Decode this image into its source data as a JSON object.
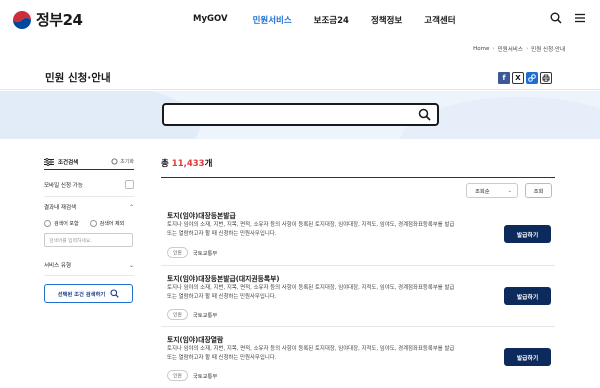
{
  "header": {
    "logo_text": "정부24",
    "nav": [
      {
        "label": "MyGOV"
      },
      {
        "label": "민원서비스",
        "active": true
      },
      {
        "label": "보조금24"
      },
      {
        "label": "정책정보"
      },
      {
        "label": "고객센터"
      }
    ]
  },
  "breadcrumb": [
    "Home",
    "민원서비스",
    "민원 신청·안내"
  ],
  "page_title": "민원 신청·안내",
  "share_icons": [
    "facebook-icon",
    "x-icon",
    "link-icon",
    "print-icon"
  ],
  "search": {
    "value": "",
    "placeholder": ""
  },
  "sidebar": {
    "title": "조건검색",
    "reset": "초기화",
    "mobile": "모바일 신청 가능",
    "result_search": "결과내 재검색",
    "include": "검색어 포함",
    "exclude": "검색어 제외",
    "input_placeholder": "검색어를 입력하세요.",
    "service_type": "서비스 유형",
    "apply_btn": "선택된 조건 검색하기"
  },
  "results": {
    "total_prefix": "총 ",
    "total_count": "11,433",
    "total_suffix": "개",
    "sort_value": "조회순",
    "sort_button": "조회"
  },
  "cards": [
    {
      "title": "토지(임야)대장등본발급",
      "desc1": "토지나 임야의 소재, 지번, 지목, 면적, 소유자 등의 사항이 등록된 토지대장, 임야대장, 지적도, 임야도, 경계점좌표등록부를 발급",
      "desc2": "또는 열람하고자 할 때 신청하는 민원사무입니다.",
      "tag": "인원",
      "agency": "국토교통부",
      "button": "발급하기"
    },
    {
      "title": "토지(임야)대장등본발급(대지권등록부)",
      "desc1": "토지나 임야의 소재, 지번, 지목, 면적, 소유자 등의 사항이 등록된 토지대장, 임야대장, 지적도, 임야도, 경계점좌표등록부를 발급",
      "desc2": "또는 열람하고자 할 때 신청하는 민원사무입니다.",
      "tag": "인원",
      "agency": "국토교통부",
      "button": "발급하기"
    },
    {
      "title": "토지(임야)대장열람",
      "desc1": "토지나 임야의 소재, 지번, 지목, 면적, 소유자 등의 사항이 등록된 토지대장, 임야대장, 지적도, 임야도, 경계점좌표등록부를 발급",
      "desc2": "또는 열람하고자 할 때 신청하는 민원사무입니다.",
      "tag": "인원",
      "agency": "국토교통부",
      "button": "발급하기"
    }
  ],
  "colors": {
    "accent": "#1f6fd0",
    "primary_button": "#0d2a5c",
    "count": "#e23a3a",
    "hero_bg": "#eef4fb"
  }
}
